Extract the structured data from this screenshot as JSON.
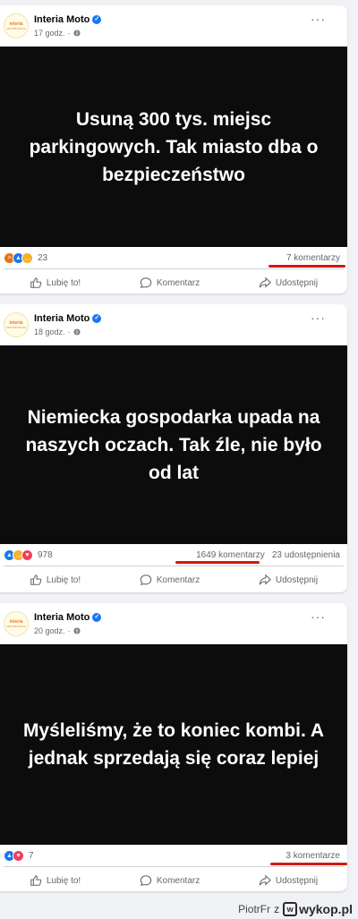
{
  "posts": [
    {
      "author": "Interia Moto",
      "time": "17 godz.",
      "headline": "Usuną 300 tys. miejsc parkingowych. Tak miasto dba o bezpieczeństwo",
      "reactions": [
        "angry",
        "like",
        "haha"
      ],
      "reaction_count": "23",
      "comments": "7 komentarzy",
      "shares": ""
    },
    {
      "author": "Interia Moto",
      "time": "18 godz.",
      "headline": "Niemiecka gospodarka upada na naszych oczach. Tak źle, nie było od lat",
      "reactions": [
        "like",
        "haha",
        "love"
      ],
      "reaction_count": "978",
      "comments": "1649 komentarzy",
      "shares": "23 udostępnienia"
    },
    {
      "author": "Interia Moto",
      "time": "20 godz.",
      "headline": "Myśleliśmy, że to koniec kombi. A jednak sprzedają się coraz lepiej",
      "reactions": [
        "like",
        "love"
      ],
      "reaction_count": "7",
      "comments": "3 komentarze",
      "shares": ""
    }
  ],
  "actions": {
    "like": "Lubię to!",
    "comment": "Komentarz",
    "share": "Udostępnij"
  },
  "logo": {
    "top": "interia",
    "bottom": "MOTORYZACJA"
  },
  "watermark": {
    "user": "PiotrFr",
    "separator": "z",
    "site": "wykop.pl",
    "icon": "w"
  },
  "colors": {
    "like": "#1877f2",
    "angry": "#e9710f",
    "haha": "#f7b125",
    "love": "#f33e58",
    "underline": "#d21a0a"
  }
}
